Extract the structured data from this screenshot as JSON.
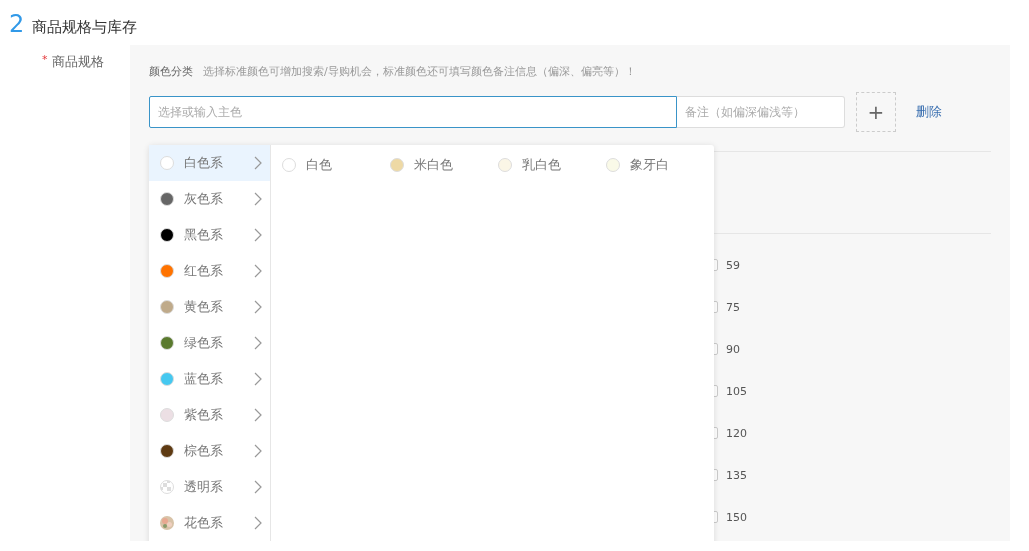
{
  "section": {
    "number": "2",
    "title": "商品规格与库存"
  },
  "spec_label": {
    "required_mark": "*",
    "label": "商品规格"
  },
  "color_group": {
    "label": "颜色分类",
    "hint": "选择标准颜色可增加搜索/导购机会，标准颜色还可填写颜色备注信息（偏深、偏亮等）！",
    "main_color_field": {
      "placeholder": "选择或输入主色"
    },
    "note_field": {
      "placeholder": "备注（如偏深偏浅等）"
    },
    "add_button": "+",
    "delete_link": "删除"
  },
  "dropdown": {
    "categories": [
      {
        "label": "白色系",
        "kind": "solid",
        "color": "#ffffff",
        "selected": true
      },
      {
        "label": "灰色系",
        "kind": "solid",
        "color": "#666666",
        "selected": false
      },
      {
        "label": "黑色系",
        "kind": "solid",
        "color": "#000000",
        "selected": false
      },
      {
        "label": "红色系",
        "kind": "solid",
        "color": "#ff7300",
        "selected": false
      },
      {
        "label": "黄色系",
        "kind": "solid",
        "color": "#bfaa8a",
        "selected": false
      },
      {
        "label": "绿色系",
        "kind": "solid",
        "color": "#5a7a2e",
        "selected": false
      },
      {
        "label": "蓝色系",
        "kind": "solid",
        "color": "#45c8f0",
        "selected": false
      },
      {
        "label": "紫色系",
        "kind": "solid",
        "color": "#ecdfe4",
        "selected": false
      },
      {
        "label": "棕色系",
        "kind": "solid",
        "color": "#5e3a12",
        "selected": false
      },
      {
        "label": "透明系",
        "kind": "transparent",
        "selected": false
      },
      {
        "label": "花色系",
        "kind": "pattern",
        "selected": false
      }
    ],
    "options": [
      {
        "label": "白色",
        "color": "#ffffff"
      },
      {
        "label": "米白色",
        "color": "#eed9a5"
      },
      {
        "label": "乳白色",
        "color": "#fbf6e6"
      },
      {
        "label": "象牙白",
        "color": "#fafae8"
      }
    ]
  },
  "sizes": [
    {
      "label": "59",
      "checked": false
    },
    {
      "label": "75",
      "checked": false
    },
    {
      "label": "90",
      "checked": false
    },
    {
      "label": "105",
      "checked": false
    },
    {
      "label": "120",
      "checked": false
    },
    {
      "label": "135",
      "checked": false
    },
    {
      "label": "150",
      "checked": false
    }
  ]
}
